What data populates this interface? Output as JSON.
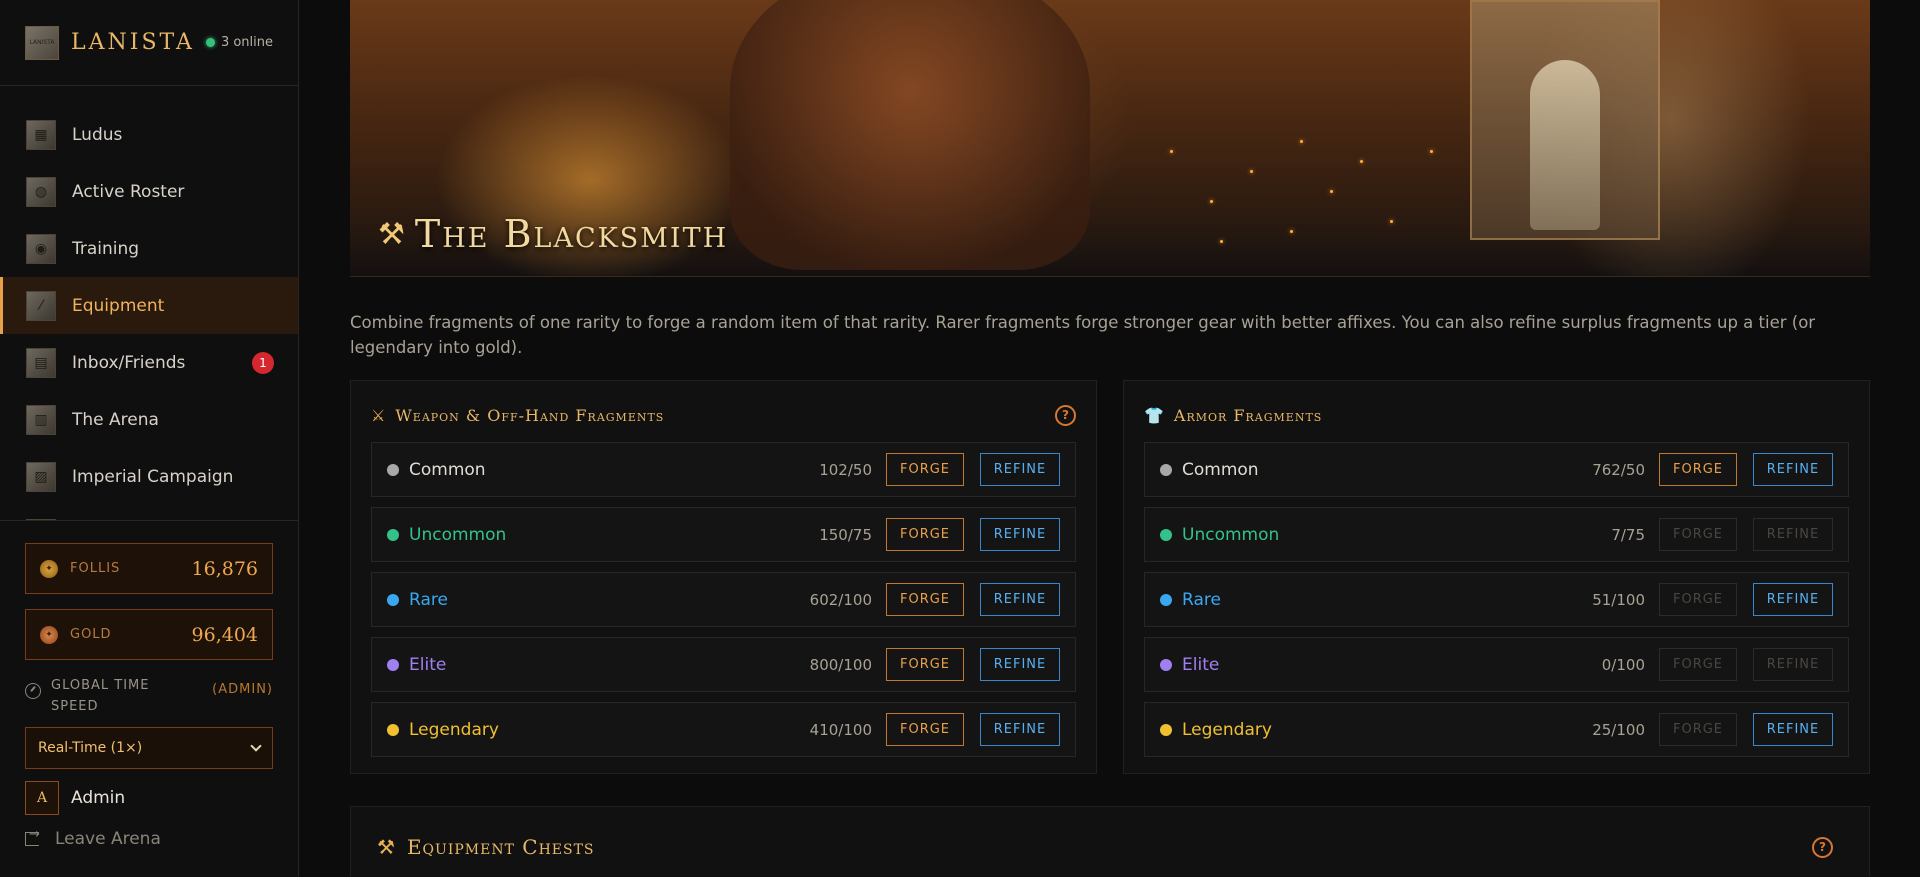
{
  "brand": {
    "name": "LANISTA",
    "online": "3 online",
    "logo_text": "LANISTA"
  },
  "nav": {
    "items": [
      {
        "label": "Ludus",
        "icon": "ludus-icon"
      },
      {
        "label": "Active Roster",
        "icon": "helmet-icon"
      },
      {
        "label": "Training",
        "icon": "shield-icon"
      },
      {
        "label": "Equipment",
        "icon": "sword-icon",
        "active": true
      },
      {
        "label": "Inbox/Friends",
        "icon": "inbox-icon",
        "badge": "1"
      },
      {
        "label": "The Arena",
        "icon": "colosseum-icon"
      },
      {
        "label": "Imperial Campaign",
        "icon": "map-icon"
      }
    ]
  },
  "wallet": {
    "follis": {
      "label": "FOLLIS",
      "value": "16,876"
    },
    "gold": {
      "label": "GOLD",
      "value": "96,404"
    }
  },
  "speed": {
    "label": "GLOBAL TIME SPEED",
    "admin": "(ADMIN)",
    "selected": "Real-Time (1×)"
  },
  "user": {
    "avatar": "A",
    "name": "Admin",
    "leave": "Leave Arena"
  },
  "hero": {
    "title": "The Blacksmith"
  },
  "description": "Combine fragments of one rarity to forge a random item of that rarity. Rarer fragments forge stronger gear with better affixes. You can also refine surplus fragments up a tier (or legendary into gold).",
  "buttons": {
    "forge": "FORGE",
    "refine": "REFINE"
  },
  "colors": {
    "common": "#a8a8a8",
    "uncommon": "#34c28a",
    "rare": "#3aa8f0",
    "elite": "#a080f0",
    "legendary": "#f0c030",
    "accent": "#e8a04a"
  },
  "weapon_panel": {
    "title": "Weapon & Off-Hand Fragments",
    "rows": [
      {
        "rarity": "Common",
        "count": "102/50"
      },
      {
        "rarity": "Uncommon",
        "count": "150/75"
      },
      {
        "rarity": "Rare",
        "count": "602/100"
      },
      {
        "rarity": "Elite",
        "count": "800/100"
      },
      {
        "rarity": "Legendary",
        "count": "410/100"
      }
    ]
  },
  "armor_panel": {
    "title": "Armor Fragments",
    "rows": [
      {
        "rarity": "Common",
        "count": "762/50"
      },
      {
        "rarity": "Uncommon",
        "count": "7/75"
      },
      {
        "rarity": "Rare",
        "count": "51/100"
      },
      {
        "rarity": "Elite",
        "count": "0/100"
      },
      {
        "rarity": "Legendary",
        "count": "25/100"
      }
    ]
  },
  "chests": {
    "title": "Equipment Chests"
  }
}
